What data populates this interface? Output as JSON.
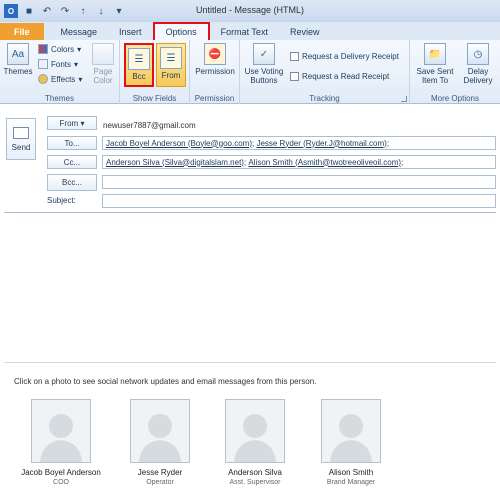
{
  "window": {
    "title": "Untitled - Message (HTML)"
  },
  "tabs": [
    "File",
    "Message",
    "Insert",
    "Options",
    "Format Text",
    "Review"
  ],
  "ribbon": {
    "themes": {
      "themes_label": "Themes",
      "colors_label": "Colors",
      "fonts_label": "Fonts",
      "effects_label": "Effects",
      "page_color_label": "Page Color",
      "group_label": "Themes"
    },
    "show_fields": {
      "bcc_label": "Bcc",
      "from_label": "From",
      "group_label": "Show Fields"
    },
    "permission": {
      "permission_label": "Permission",
      "group_label": "Permission"
    },
    "tracking": {
      "voting_label": "Use Voting Buttons",
      "delivery_receipt": "Request a Delivery Receipt",
      "read_receipt": "Request a Read Receipt",
      "group_label": "Tracking"
    },
    "more_options": {
      "save_sent_label": "Save Sent Item To",
      "delay_label": "Delay Delivery",
      "group_label": "More Options"
    }
  },
  "compose": {
    "send_label": "Send",
    "from_label": "From",
    "from_value": "newuser7887@gmail.com",
    "to_label": "To...",
    "to_recipients": [
      "Jacob Boyel Anderson (Boyle@goo.com)",
      "Jesse Ryder (Ryder.J@hotmail.com)"
    ],
    "cc_label": "Cc...",
    "cc_recipients": [
      "Anderson Silva (Silva@digitalslam.net)",
      "Alison Smith (Asmith@twotreeoliveoil.com)"
    ],
    "bcc_label": "Bcc...",
    "subject_label": "Subject:"
  },
  "people_pane": {
    "message": "Click on a photo to see social network updates and email messages from this person.",
    "people": [
      {
        "name": "Jacob Boyel Anderson",
        "title": "COO"
      },
      {
        "name": "Jesse Ryder",
        "title": "Operator"
      },
      {
        "name": "Anderson Silva",
        "title": "Asst. Supervisor"
      },
      {
        "name": "Alison Smith",
        "title": "Brand Manager"
      }
    ]
  }
}
